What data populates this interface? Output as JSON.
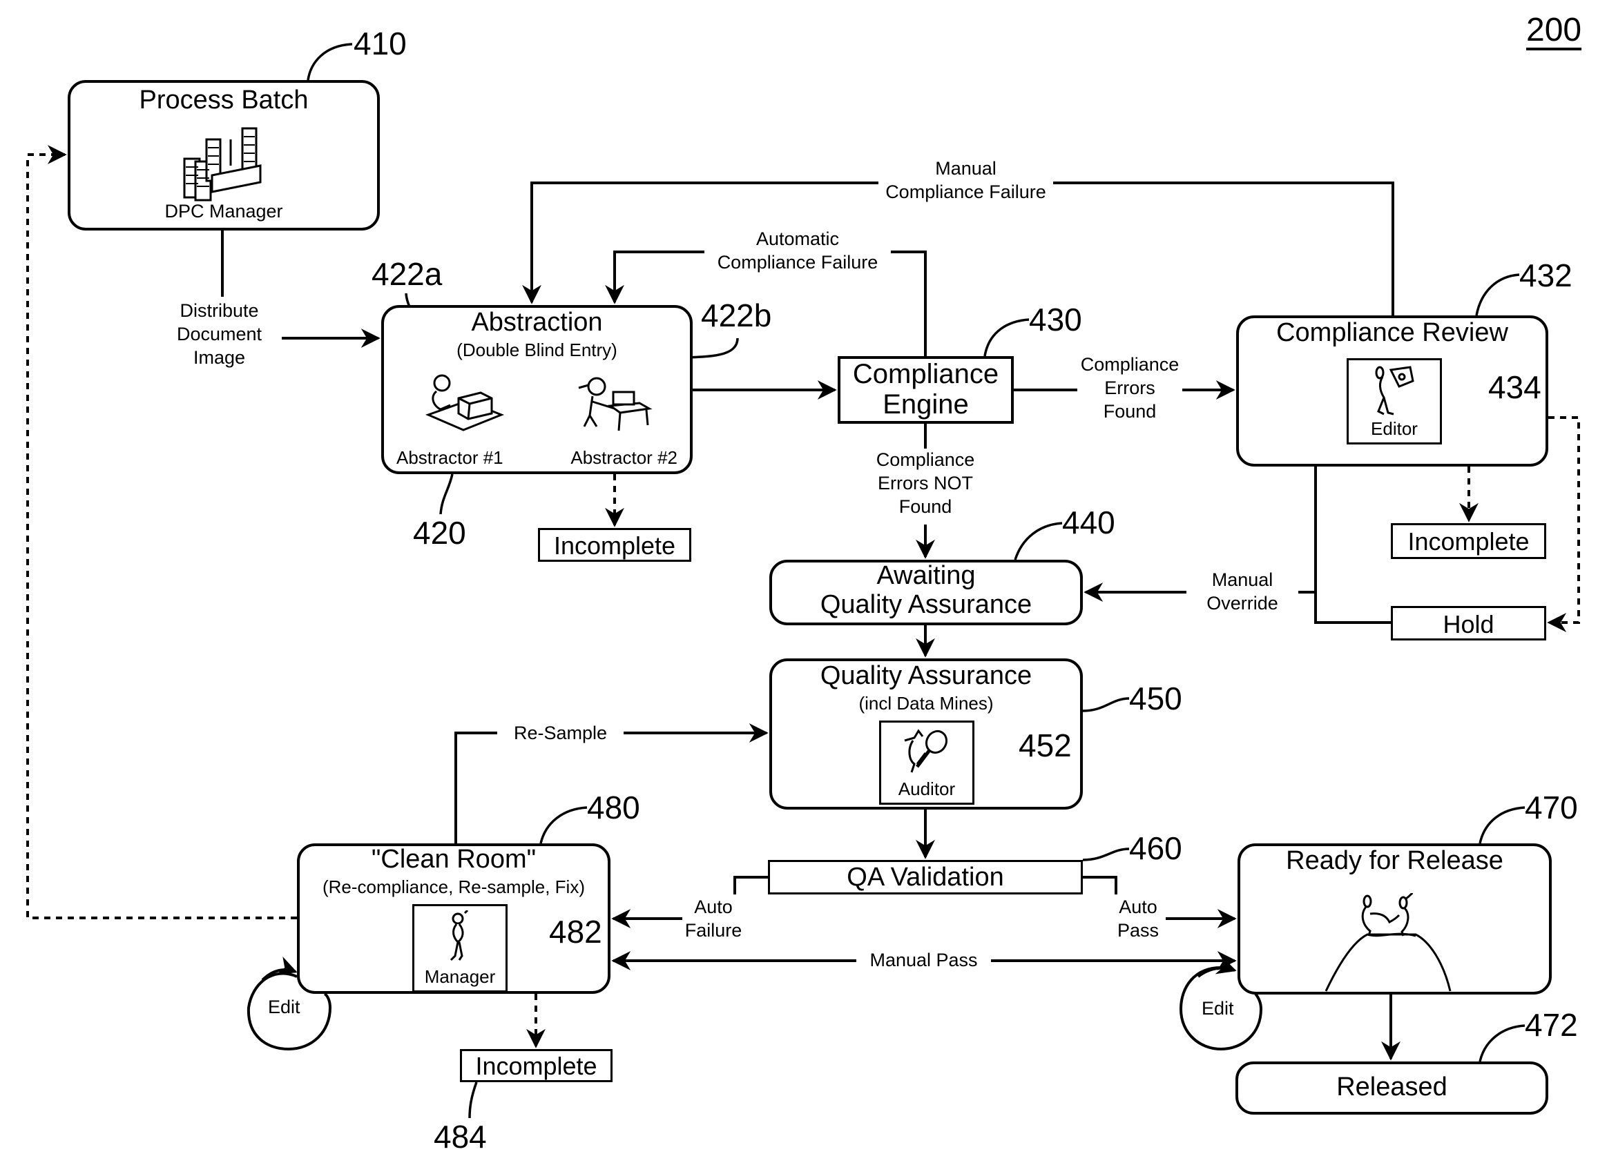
{
  "figure": {
    "number": "200",
    "nodes": {
      "process_batch": {
        "ref": "410",
        "title": "Process Batch",
        "role": "DPC Manager",
        "icon": "factory-icon"
      },
      "abstraction": {
        "ref": "420",
        "title": "Abstraction",
        "subtitle": "(Double Blind Entry)",
        "abstractors": [
          {
            "ref": "422a",
            "role": "Abstractor #1",
            "icon": "person-at-computer-icon"
          },
          {
            "ref": "422b",
            "role": "Abstractor #2",
            "icon": "person-at-desk-icon"
          }
        ]
      },
      "incomplete_abstraction": {
        "label": "Incomplete"
      },
      "compliance_engine": {
        "ref": "430",
        "title_line1": "Compliance",
        "title_line2": "Engine"
      },
      "compliance_review": {
        "ref": "432",
        "title": "Compliance Review",
        "role_ref": "434",
        "role": "Editor",
        "icon": "editor-icon"
      },
      "incomplete_review": {
        "label": "Incomplete"
      },
      "hold": {
        "label": "Hold"
      },
      "awaiting_qa": {
        "ref": "440",
        "title_line1": "Awaiting",
        "title_line2": "Quality Assurance"
      },
      "quality_assurance": {
        "ref": "450",
        "title": "Quality Assurance",
        "subtitle": "(incl Data Mines)",
        "role_ref": "452",
        "role": "Auditor",
        "icon": "auditor-magnifier-icon"
      },
      "qa_validation": {
        "ref": "460",
        "title": "QA Validation"
      },
      "ready_for_release": {
        "ref": "470",
        "title": "Ready for Release",
        "icon": "handshake-on-hill-icon"
      },
      "released": {
        "ref": "472",
        "title": "Released"
      },
      "clean_room": {
        "ref": "480",
        "title": "\"Clean Room\"",
        "subtitle": "(Re-compliance, Re-sample, Fix)",
        "role_ref": "482",
        "role": "Manager",
        "icon": "manager-icon"
      },
      "incomplete_clean_room": {
        "ref": "484",
        "label": "Incomplete"
      }
    },
    "edges": {
      "distribute": {
        "line1": "Distribute",
        "line2": "Document",
        "line3": "Image"
      },
      "manual_compliance_failure": {
        "line1": "Manual",
        "line2": "Compliance Failure"
      },
      "automatic_compliance_failure": {
        "line1": "Automatic",
        "line2": "Compliance Failure"
      },
      "errors_found": {
        "line1": "Compliance",
        "line2": "Errors",
        "line3": "Found"
      },
      "errors_not_found": {
        "line1": "Compliance",
        "line2": "Errors NOT",
        "line3": "Found"
      },
      "manual_override": {
        "line1": "Manual",
        "line2": "Override"
      },
      "re_sample": {
        "label": "Re-Sample"
      },
      "auto_failure": {
        "line1": "Auto",
        "line2": "Failure"
      },
      "auto_pass": {
        "line1": "Auto",
        "line2": "Pass"
      },
      "manual_pass": {
        "label": "Manual Pass"
      },
      "edit_left": {
        "label": "Edit"
      },
      "edit_right": {
        "label": "Edit"
      }
    }
  }
}
